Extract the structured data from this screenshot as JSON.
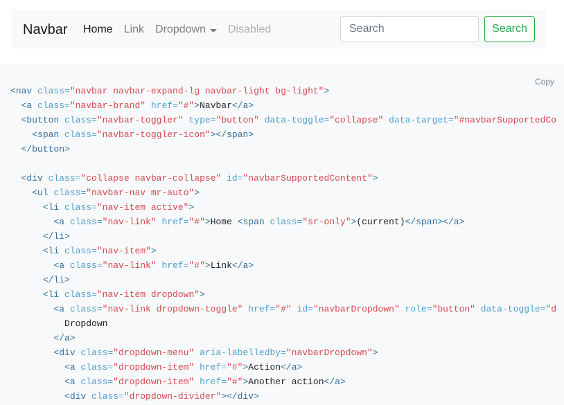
{
  "navbar": {
    "brand": "Navbar",
    "items": [
      {
        "label": "Home",
        "state": "active"
      },
      {
        "label": "Link",
        "state": "normal"
      },
      {
        "label": "Dropdown",
        "state": "dropdown"
      },
      {
        "label": "Disabled",
        "state": "disabled"
      }
    ],
    "search": {
      "placeholder": "Search",
      "button_label": "Search"
    }
  },
  "code_panel": {
    "copy_label": "Copy",
    "lines": [
      [
        [
          "t",
          "<nav "
        ],
        [
          "an",
          "class="
        ],
        [
          "av",
          "\"navbar navbar-expand-lg navbar-light bg-light\""
        ],
        [
          "t",
          ">"
        ]
      ],
      [
        [
          "p",
          "  "
        ],
        [
          "t",
          "<a "
        ],
        [
          "an",
          "class="
        ],
        [
          "av",
          "\"navbar-brand\" "
        ],
        [
          "an",
          "href="
        ],
        [
          "av",
          "\"#\""
        ],
        [
          "t",
          ">"
        ],
        [
          "p",
          "Navbar"
        ],
        [
          "t",
          "</a>"
        ]
      ],
      [
        [
          "p",
          "  "
        ],
        [
          "t",
          "<button "
        ],
        [
          "an",
          "class="
        ],
        [
          "av",
          "\"navbar-toggler\" "
        ],
        [
          "an",
          "type="
        ],
        [
          "av",
          "\"button\" "
        ],
        [
          "an",
          "data-toggle="
        ],
        [
          "av",
          "\"collapse\" "
        ],
        [
          "an",
          "data-target="
        ],
        [
          "av",
          "\"#navbarSupportedCo"
        ]
      ],
      [
        [
          "p",
          "    "
        ],
        [
          "t",
          "<span "
        ],
        [
          "an",
          "class="
        ],
        [
          "av",
          "\"navbar-toggler-icon\""
        ],
        [
          "t",
          "></span>"
        ]
      ],
      [
        [
          "p",
          "  "
        ],
        [
          "t",
          "</button>"
        ]
      ],
      [],
      [
        [
          "p",
          "  "
        ],
        [
          "t",
          "<div "
        ],
        [
          "an",
          "class="
        ],
        [
          "av",
          "\"collapse navbar-collapse\" "
        ],
        [
          "an",
          "id="
        ],
        [
          "av",
          "\"navbarSupportedContent\""
        ],
        [
          "t",
          ">"
        ]
      ],
      [
        [
          "p",
          "    "
        ],
        [
          "t",
          "<ul "
        ],
        [
          "an",
          "class="
        ],
        [
          "av",
          "\"navbar-nav mr-auto\""
        ],
        [
          "t",
          ">"
        ]
      ],
      [
        [
          "p",
          "      "
        ],
        [
          "t",
          "<li "
        ],
        [
          "an",
          "class="
        ],
        [
          "av",
          "\"nav-item active\""
        ],
        [
          "t",
          ">"
        ]
      ],
      [
        [
          "p",
          "        "
        ],
        [
          "t",
          "<a "
        ],
        [
          "an",
          "class="
        ],
        [
          "av",
          "\"nav-link\" "
        ],
        [
          "an",
          "href="
        ],
        [
          "av",
          "\"#\""
        ],
        [
          "t",
          ">"
        ],
        [
          "p",
          "Home "
        ],
        [
          "t",
          "<span "
        ],
        [
          "an",
          "class="
        ],
        [
          "av",
          "\"sr-only\""
        ],
        [
          "t",
          ">"
        ],
        [
          "p",
          "(current)"
        ],
        [
          "t",
          "</span></a>"
        ]
      ],
      [
        [
          "p",
          "      "
        ],
        [
          "t",
          "</li>"
        ]
      ],
      [
        [
          "p",
          "      "
        ],
        [
          "t",
          "<li "
        ],
        [
          "an",
          "class="
        ],
        [
          "av",
          "\"nav-item\""
        ],
        [
          "t",
          ">"
        ]
      ],
      [
        [
          "p",
          "        "
        ],
        [
          "t",
          "<a "
        ],
        [
          "an",
          "class="
        ],
        [
          "av",
          "\"nav-link\" "
        ],
        [
          "an",
          "href="
        ],
        [
          "av",
          "\"#\""
        ],
        [
          "t",
          ">"
        ],
        [
          "p",
          "Link"
        ],
        [
          "t",
          "</a>"
        ]
      ],
      [
        [
          "p",
          "      "
        ],
        [
          "t",
          "</li>"
        ]
      ],
      [
        [
          "p",
          "      "
        ],
        [
          "t",
          "<li "
        ],
        [
          "an",
          "class="
        ],
        [
          "av",
          "\"nav-item dropdown\""
        ],
        [
          "t",
          ">"
        ]
      ],
      [
        [
          "p",
          "        "
        ],
        [
          "t",
          "<a "
        ],
        [
          "an",
          "class="
        ],
        [
          "av",
          "\"nav-link dropdown-toggle\" "
        ],
        [
          "an",
          "href="
        ],
        [
          "av",
          "\"#\" "
        ],
        [
          "an",
          "id="
        ],
        [
          "av",
          "\"navbarDropdown\" "
        ],
        [
          "an",
          "role="
        ],
        [
          "av",
          "\"button\" "
        ],
        [
          "an",
          "data-toggle="
        ],
        [
          "av",
          "\"d"
        ]
      ],
      [
        [
          "p",
          "          Dropdown"
        ]
      ],
      [
        [
          "p",
          "        "
        ],
        [
          "t",
          "</a>"
        ]
      ],
      [
        [
          "p",
          "        "
        ],
        [
          "t",
          "<div "
        ],
        [
          "an",
          "class="
        ],
        [
          "av",
          "\"dropdown-menu\" "
        ],
        [
          "an",
          "aria-labelledby="
        ],
        [
          "av",
          "\"navbarDropdown\""
        ],
        [
          "t",
          ">"
        ]
      ],
      [
        [
          "p",
          "          "
        ],
        [
          "t",
          "<a "
        ],
        [
          "an",
          "class="
        ],
        [
          "av",
          "\"dropdown-item\" "
        ],
        [
          "an",
          "href="
        ],
        [
          "av",
          "\"#\""
        ],
        [
          "t",
          ">"
        ],
        [
          "p",
          "Action"
        ],
        [
          "t",
          "</a>"
        ]
      ],
      [
        [
          "p",
          "          "
        ],
        [
          "t",
          "<a "
        ],
        [
          "an",
          "class="
        ],
        [
          "av",
          "\"dropdown-item\" "
        ],
        [
          "an",
          "href="
        ],
        [
          "av",
          "\"#\""
        ],
        [
          "t",
          ">"
        ],
        [
          "p",
          "Another action"
        ],
        [
          "t",
          "</a>"
        ]
      ],
      [
        [
          "p",
          "          "
        ],
        [
          "t",
          "<div "
        ],
        [
          "an",
          "class="
        ],
        [
          "av",
          "\"dropdown-divider\""
        ],
        [
          "t",
          "></div>"
        ]
      ]
    ]
  }
}
